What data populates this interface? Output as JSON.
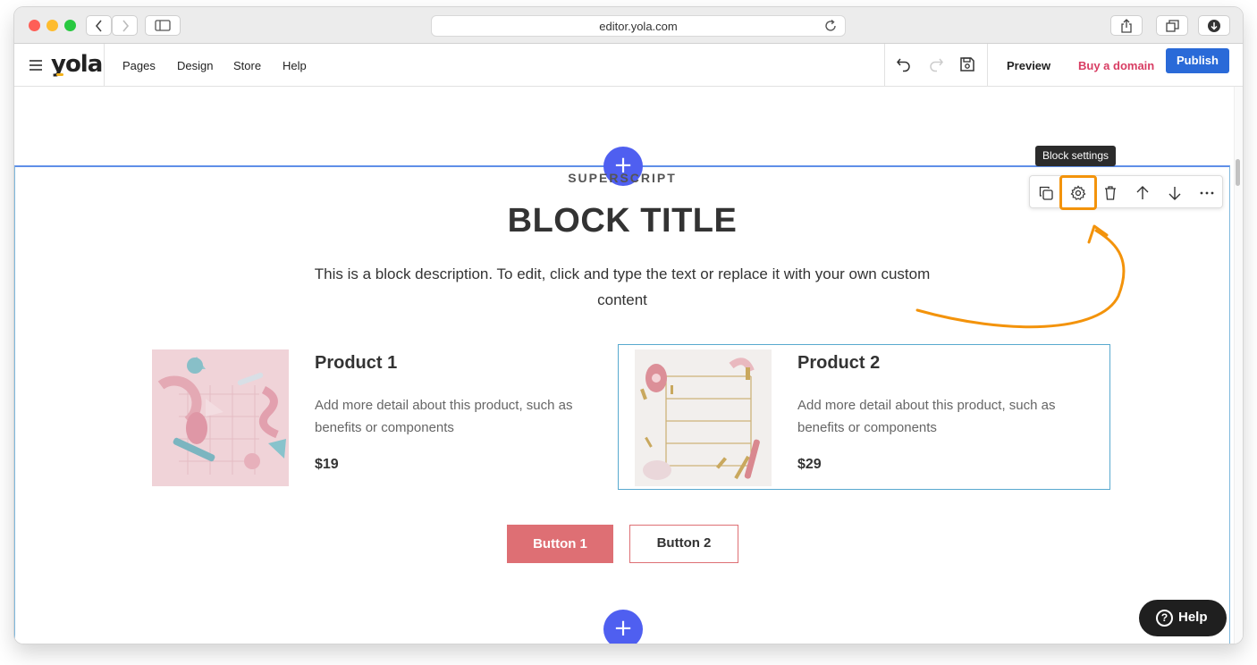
{
  "browser": {
    "url": "editor.yola.com",
    "traffic_colors": [
      "#fe5f57",
      "#febc2e",
      "#28c840"
    ]
  },
  "editor": {
    "logo": "yola",
    "nav": [
      "Pages",
      "Design",
      "Store",
      "Help"
    ],
    "preview_label": "Preview",
    "domain_label": "Buy a domain",
    "publish_label": "Publish",
    "colors": {
      "publish": "#2a6ad8",
      "domain": "#d83d63",
      "add": "#4f5ff0",
      "highlight": "#f3930b"
    }
  },
  "block": {
    "superscript": "SUPERSCRIPT",
    "title": "BLOCK TITLE",
    "description": "This is a block description. To edit, click and type the text or replace it with your own custom content",
    "products": [
      {
        "title": "Product 1",
        "description": "Add more detail about this product, such as benefits or components",
        "price": "$19"
      },
      {
        "title": "Product 2",
        "description": "Add more detail about this product, such as benefits or components",
        "price": "$29"
      }
    ],
    "button1_label": "Button 1",
    "button2_label": "Button 2",
    "add_symbol": "+"
  },
  "toolbar": {
    "tooltip": "Block settings",
    "items": [
      "duplicate-icon",
      "gear-icon",
      "trash-icon",
      "arrow-up-icon",
      "arrow-down-icon",
      "more-icon"
    ]
  },
  "help_label": "Help"
}
